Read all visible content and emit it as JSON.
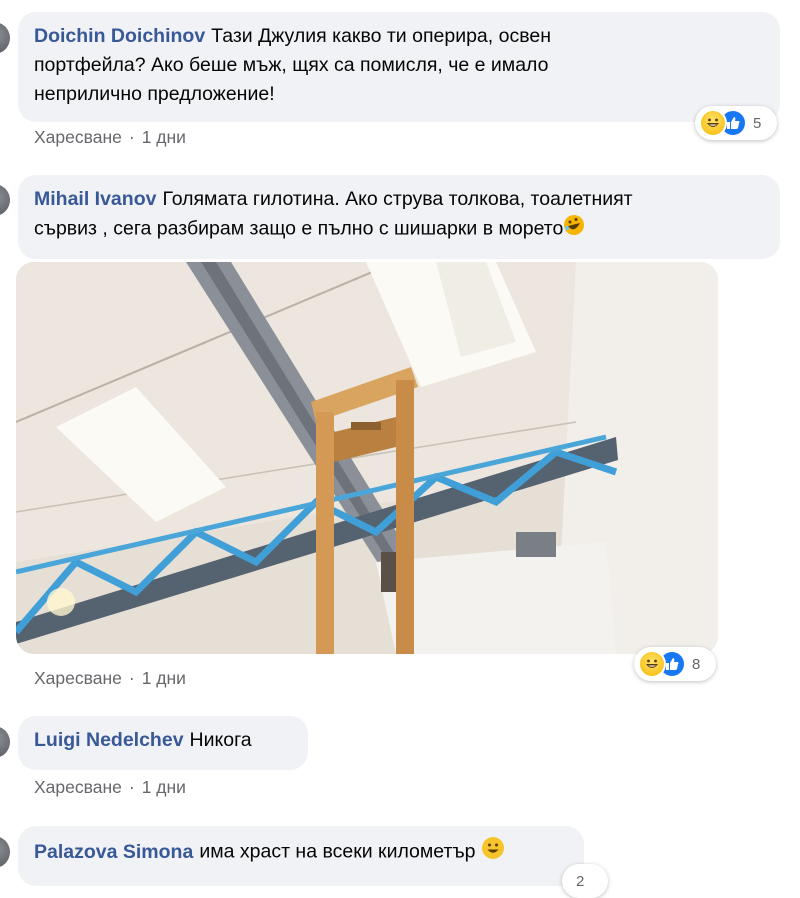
{
  "comments": [
    {
      "author": "Doichin Doichinov",
      "text_line1": "Тази Джулия какво ти оперира, освен",
      "text_line2": "портфейла? Ако беше мъж, щях са помисля, че е имало",
      "text_line3": "неприлично предложение!",
      "like_label": "Харесване",
      "time": "1 дни",
      "reaction_count": "5",
      "reaction_icons": [
        "haha-icon",
        "like-icon"
      ]
    },
    {
      "author": "Mihail Ivanov",
      "text_line1": "Голямата гилотина. Ако струва толкова, тоалетният",
      "text_line2": "сървиз , сега разбирам защо е пълно с шишарки в морето",
      "like_label": "Харесване",
      "time": "1 дни",
      "reaction_count": "8",
      "reaction_icons": [
        "haha-icon",
        "like-icon"
      ],
      "attachment": "guillotine-photo"
    },
    {
      "author": "Luigi Nedelchev",
      "text_line1": "Никога",
      "like_label": "Харесване",
      "time": "1 дни"
    },
    {
      "author": "Palazova Simona",
      "text_line1": "има храст на всеки километър",
      "reaction_count": "2"
    }
  ],
  "colors": {
    "author": "#385898",
    "bubble": "#f0f2f5",
    "meta": "#65676b",
    "like_blue": "#1877f2"
  }
}
